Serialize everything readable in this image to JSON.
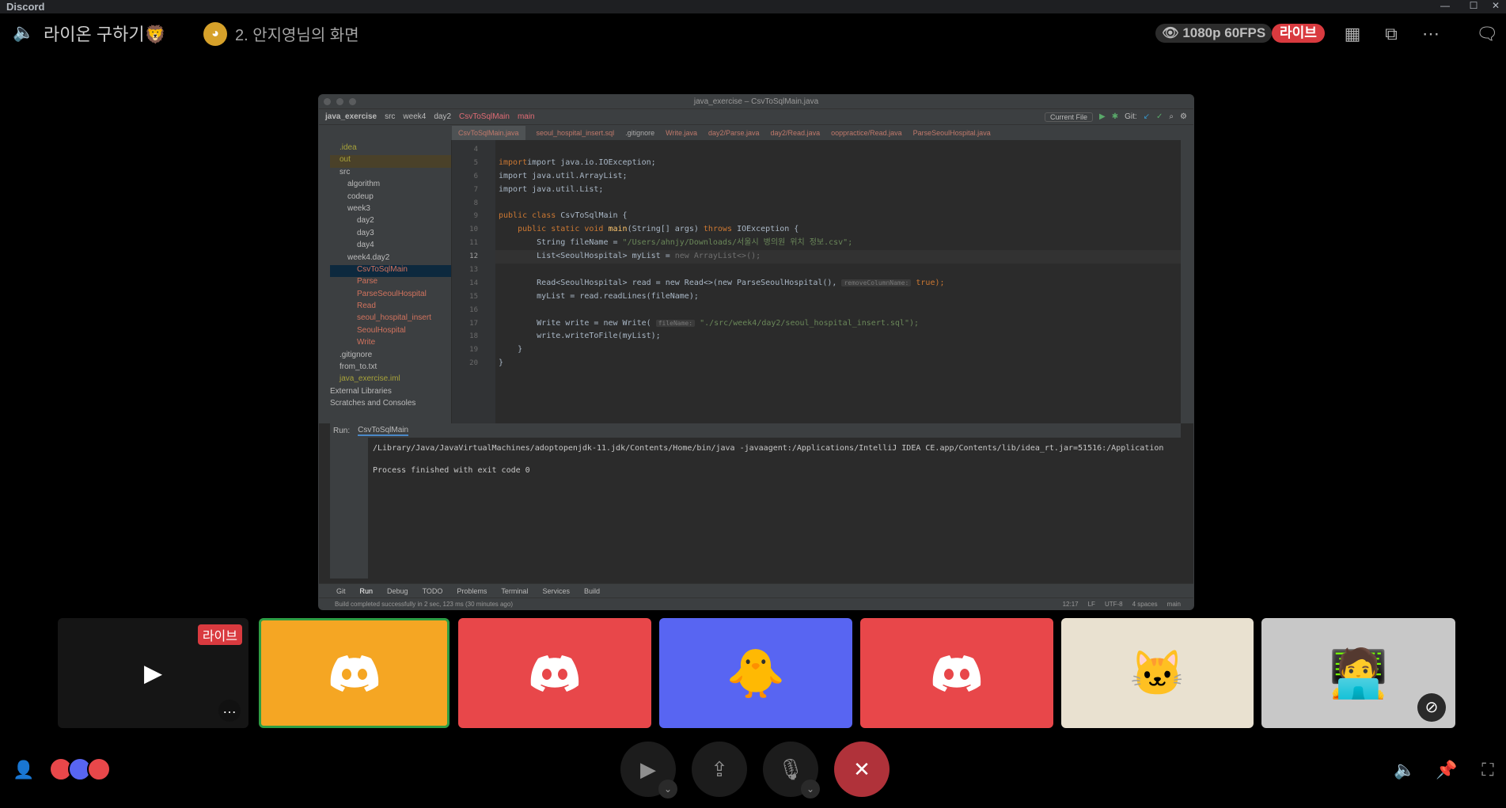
{
  "window": {
    "app_title": "Discord"
  },
  "header": {
    "channel_name": "라이온 구하기🦁",
    "stream_source": "2. 안지영님의 화면",
    "quality": "1080p 60FPS",
    "live_label": "라이브"
  },
  "ide": {
    "title": "java_exercise – CsvToSqlMain.java",
    "breadcrumbs": [
      "java_exercise",
      "src",
      "week4",
      "day2",
      "CsvToSqlMain",
      "main"
    ],
    "current_file": "Current File",
    "git_label": "Git:",
    "tabs": [
      "CsvToSqlMain.java",
      "seoul_hospital_insert.sql",
      ".gitignore",
      "Write.java",
      "day2/Parse.java",
      "day2/Read.java",
      "ooppractice/Read.java",
      "ParseSeoulHospital.java"
    ],
    "tree": [
      ".idea",
      "out",
      "src",
      "algorithm",
      "codeup",
      "week3",
      "day2",
      "day3",
      "day4",
      "week4.day2",
      "CsvToSqlMain",
      "Parse",
      "ParseSeoulHospital",
      "Read",
      "seoul_hospital_insert",
      "SeoulHospital",
      "Write",
      ".gitignore",
      "from_to.txt",
      "java_exercise.iml",
      "External Libraries",
      "Scratches and Consoles"
    ],
    "line_numbers": [
      "4",
      "5",
      "6",
      "7",
      "8",
      "9",
      "10",
      "11",
      "12",
      "13",
      "14",
      "15",
      "16",
      "17",
      "18",
      "19",
      "20"
    ],
    "code": {
      "l5": "import java.io.IOException;",
      "l6": "import java.util.ArrayList;",
      "l7": "import java.util.List;",
      "l9a": "public class ",
      "l9b": "CsvToSqlMain {",
      "l10a": "    public static void ",
      "l10b": "main",
      "l10c": "(String[] args) ",
      "l10d": "throws ",
      "l10e": "IOException {",
      "l11a": "        String fileName = ",
      "l11b": "\"/Users/ahnjy/Downloads/서울시 병의원 위치 정보.csv\";",
      "l12a": "        List<SeoulHospital> myList = ",
      "l12b": "new ArrayList<>();",
      "l14a": "        Read<SeoulHospital> read = ",
      "l14b": "new Read<>(new ParseSeoulHospital(), ",
      "l14hint": "removeColumnName:",
      "l14c": " true);",
      "l15": "        myList = read.readLines(fileName);",
      "l17a": "        Write write = ",
      "l17b": "new Write( ",
      "l17hint": "fileName:",
      "l17c": " \"./src/week4/day2/seoul_hospital_insert.sql\");",
      "l18": "        write.writeToFile(myList);",
      "l19": "    }",
      "l20": "}"
    },
    "run": {
      "label": "Run:",
      "config": "CsvToSqlMain",
      "cmd": "/Library/Java/JavaVirtualMachines/adoptopenjdk-11.jdk/Contents/Home/bin/java -javaagent:/Applications/IntelliJ IDEA CE.app/Contents/lib/idea_rt.jar=51516:/Application",
      "result": "Process finished with exit code 0"
    },
    "bottom_tabs": [
      "Git",
      "Run",
      "Debug",
      "TODO",
      "Problems",
      "Terminal",
      "Services",
      "Build"
    ],
    "status": "Build completed successfully in 2 sec, 123 ms (30 minutes ago)",
    "status_right": [
      "12:17",
      "LF",
      "UTF-8",
      "4 spaces",
      "main"
    ]
  },
  "tiles": {
    "live_label": "라이브",
    "colors": [
      "#f5a623",
      "#e8474a",
      "#5865f2",
      "#e8474a",
      "#e9e1d0",
      "#c8c8c8"
    ]
  }
}
